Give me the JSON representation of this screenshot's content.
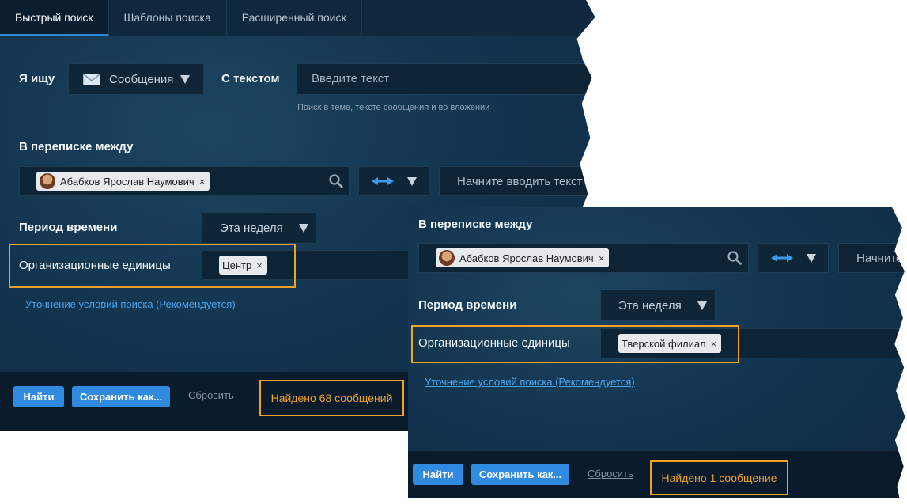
{
  "tabs": [
    {
      "label": "Быстрый поиск",
      "active": true
    },
    {
      "label": "Шаблоны поиска",
      "active": false
    },
    {
      "label": "Расширенный поиск",
      "active": false
    }
  ],
  "search": {
    "i_search_label": "Я ищу",
    "type_value": "Сообщения",
    "type_icon": "envelope-icon",
    "with_text_label": "С текстом",
    "text_placeholder": "Введите текст",
    "text_hint": "Поиск в теме, тексте сообщения и во вложении"
  },
  "correspondence": {
    "label": "В переписке между",
    "participant": "Абабков Ярослав Наумович",
    "participant_icon": "avatar",
    "direction_icon": "bidirectional-arrow-icon",
    "second_placeholder": "Начните вводить текст",
    "second_placeholder_short": "Начните"
  },
  "period": {
    "label": "Период времени",
    "value": "Эта неделя"
  },
  "org_units": {
    "label": "Организационные единицы"
  },
  "refine_link": "Уточнение условий поиска (Рекомендуется)",
  "buttons": {
    "find": "Найти",
    "save_as": "Сохранить как...",
    "reset": "Сбросить"
  },
  "panel_a": {
    "org_unit_chip": "Центр",
    "result": "Найдено 68 сообщений"
  },
  "panel_b": {
    "org_unit_chip": "Тверской филиал",
    "result": "Найдено 1 сообщение"
  },
  "colors": {
    "highlight": "#f0a12a",
    "button": "#2f8ae0",
    "link": "#4aa6f2",
    "panel_bg": "#133550"
  }
}
